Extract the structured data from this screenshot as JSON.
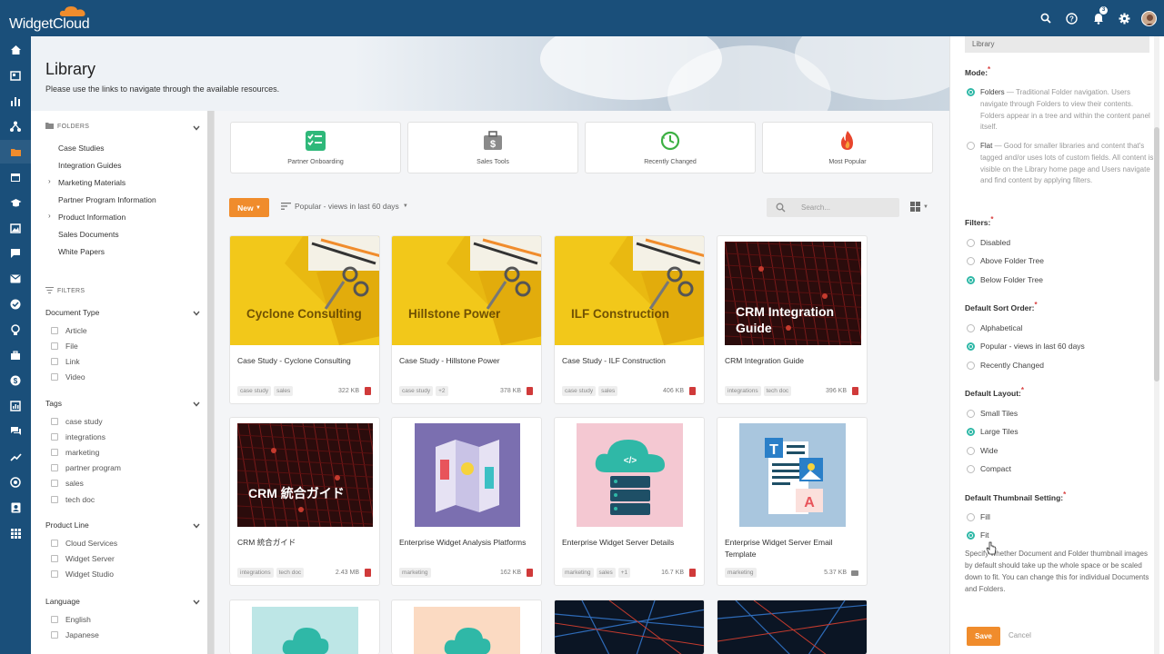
{
  "app": {
    "logo_text": "WidgetCloud",
    "notification_count": "3"
  },
  "header": {
    "title": "Library",
    "subtitle": "Please use the links to navigate through the available resources."
  },
  "sidebar": {
    "folders_heading": "FOLDERS",
    "folders": [
      {
        "label": "Case Studies",
        "expandable": false
      },
      {
        "label": "Integration Guides",
        "expandable": false
      },
      {
        "label": "Marketing Materials",
        "expandable": true
      },
      {
        "label": "Partner Program Information",
        "expandable": false
      },
      {
        "label": "Product Information",
        "expandable": true
      },
      {
        "label": "Sales Documents",
        "expandable": false
      },
      {
        "label": "White Papers",
        "expandable": false
      }
    ],
    "filters_heading": "FILTERS",
    "filter_groups": [
      {
        "title": "Document Type",
        "options": [
          "Article",
          "File",
          "Link",
          "Video"
        ]
      },
      {
        "title": "Tags",
        "options": [
          "case study",
          "integrations",
          "marketing",
          "partner program",
          "sales",
          "tech doc"
        ]
      },
      {
        "title": "Product Line",
        "options": [
          "Cloud Services",
          "Widget Server",
          "Widget Studio"
        ]
      },
      {
        "title": "Language",
        "options": [
          "English",
          "Japanese"
        ]
      }
    ]
  },
  "quick_links": [
    {
      "label": "Partner Onboarding",
      "icon": "checklist-icon",
      "color": "#2fb87a"
    },
    {
      "label": "Sales Tools",
      "icon": "briefcase-dollar-icon",
      "color": "#888888"
    },
    {
      "label": "Recently Changed",
      "icon": "clock-history-icon",
      "color": "#3cb043"
    },
    {
      "label": "Most Popular",
      "icon": "fire-icon",
      "color": "#e8452c"
    }
  ],
  "toolbar": {
    "new_label": "New",
    "sort_label": "Popular - views in last 60 days",
    "search_placeholder": "Search..."
  },
  "cards": [
    {
      "title": "Case Study - Cyclone Consulting",
      "thumb_text": "Cyclone Consulting",
      "tags": [
        "case study",
        "sales"
      ],
      "size": "322 KB"
    },
    {
      "title": "Case Study - Hillstone Power",
      "thumb_text": "Hillstone Power",
      "tags": [
        "case study",
        "+2"
      ],
      "size": "378 KB"
    },
    {
      "title": "Case Study - ILF Construction",
      "thumb_text": "ILF Construction",
      "tags": [
        "case study",
        "sales"
      ],
      "size": "406 KB"
    },
    {
      "title": "CRM Integration Guide",
      "thumb_text": "CRM Integration Guide",
      "tags": [
        "integrations",
        "tech doc"
      ],
      "size": "396 KB"
    },
    {
      "title": "CRM 統合ガイド",
      "thumb_text": "CRM 統合ガイド",
      "tags": [
        "integrations",
        "tech doc"
      ],
      "size": "2.43 MB"
    },
    {
      "title": "Enterprise Widget Analysis Platforms",
      "tags": [
        "marketing"
      ],
      "size": "162 KB"
    },
    {
      "title": "Enterprise Widget Server Details",
      "tags": [
        "marketing",
        "sales",
        "+1"
      ],
      "size": "16.7 KB"
    },
    {
      "title": "Enterprise Widget Server Email Template",
      "tags": [
        "marketing"
      ],
      "size": "5.37 KB"
    }
  ],
  "settings": {
    "title_value": "Library",
    "mode_label": "Mode:",
    "mode_folders_label": "Folders",
    "mode_folders_desc": " — Traditional Folder navigation. Users navigate through Folders to view their contents. Folders appear in a tree and within the content panel itself.",
    "mode_flat_label": "Flat",
    "mode_flat_desc": " — Good for smaller libraries and content that's tagged and/or uses lots of custom fields. All content is visible on the Library home page and Users navigate and find content by applying filters.",
    "filters_label": "Filters:",
    "filters_options": [
      "Disabled",
      "Above Folder Tree",
      "Below Folder Tree"
    ],
    "sort_label": "Default Sort Order:",
    "sort_options": [
      "Alphabetical",
      "Popular - views in last 60 days",
      "Recently Changed"
    ],
    "layout_label": "Default Layout:",
    "layout_options": [
      "Small Tiles",
      "Large Tiles",
      "Wide",
      "Compact"
    ],
    "thumb_label": "Default Thumbnail Setting:",
    "thumb_options": [
      "Fill",
      "Fit"
    ],
    "thumb_help": "Specify whether Document and Folder thumbnail images by default should take up the whole space or be scaled down to fit. You can change this for individual Documents and Folders.",
    "save_label": "Save",
    "cancel_label": "Cancel"
  },
  "colors": {
    "brand": "#1a4f7a",
    "accent": "#f08c2c",
    "radio": "#2fb8a7",
    "thumb_yellow": "#f2c81a"
  }
}
